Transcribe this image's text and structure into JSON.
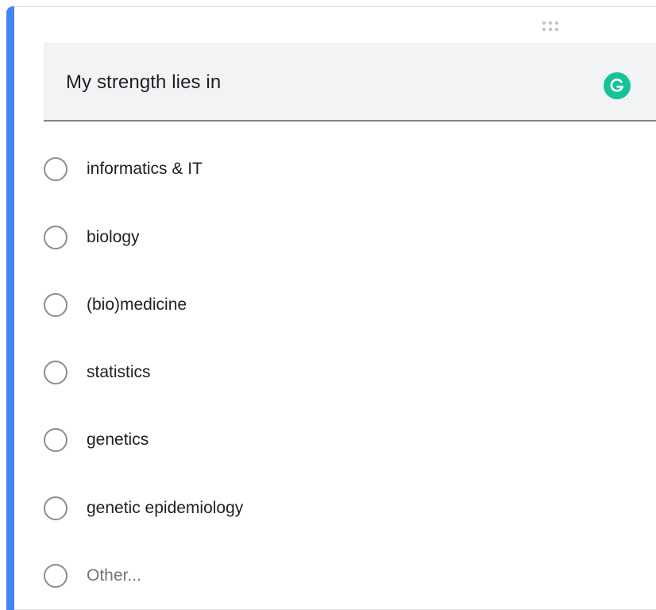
{
  "question": {
    "title": "My strength lies in"
  },
  "grammarly": {
    "icon": "grammarly-g-icon",
    "color": "#15c39a"
  },
  "accent_color": "#4285f4",
  "options": [
    {
      "label": "informatics & IT"
    },
    {
      "label": "biology"
    },
    {
      "label": "(bio)medicine"
    },
    {
      "label": "statistics"
    },
    {
      "label": "genetics"
    },
    {
      "label": "genetic epidemiology"
    },
    {
      "label": "Other..."
    }
  ]
}
